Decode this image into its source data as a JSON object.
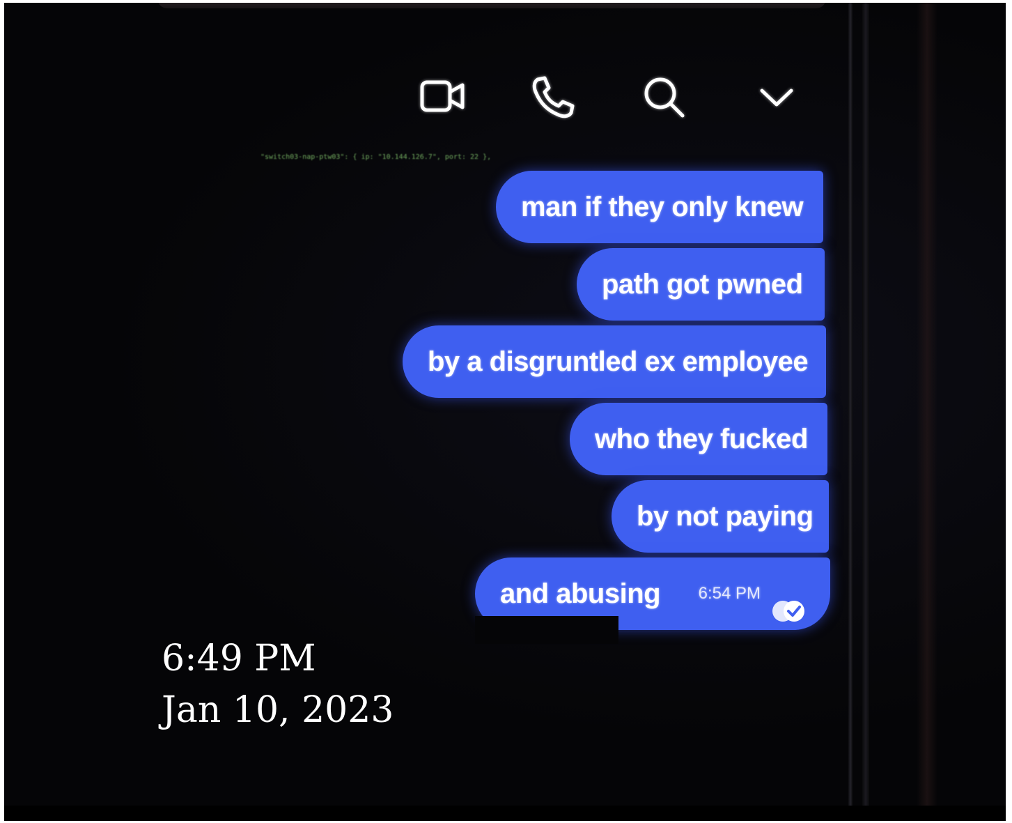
{
  "header": {
    "icons": [
      "video-call-icon",
      "phone-call-icon",
      "search-icon",
      "chevron-down-icon"
    ]
  },
  "terminal": {
    "line": "\"switch03-nap-ptw03\": { ip: \"10.144.126.7\", port: 22 },"
  },
  "messages": [
    {
      "text": "man if they only knew"
    },
    {
      "text": "path got pwned"
    },
    {
      "text": "by a disgruntled ex employee"
    },
    {
      "text": "who they fucked"
    },
    {
      "text": "by not paying"
    },
    {
      "text": "and abusing",
      "time": "6:54 PM",
      "status_icon": "read-receipt-icon"
    }
  ],
  "caption": {
    "time": "6:49 PM",
    "date": "Jan 10, 2023"
  },
  "colors": {
    "bubble": "#3f5ff0",
    "background": "#050507"
  }
}
